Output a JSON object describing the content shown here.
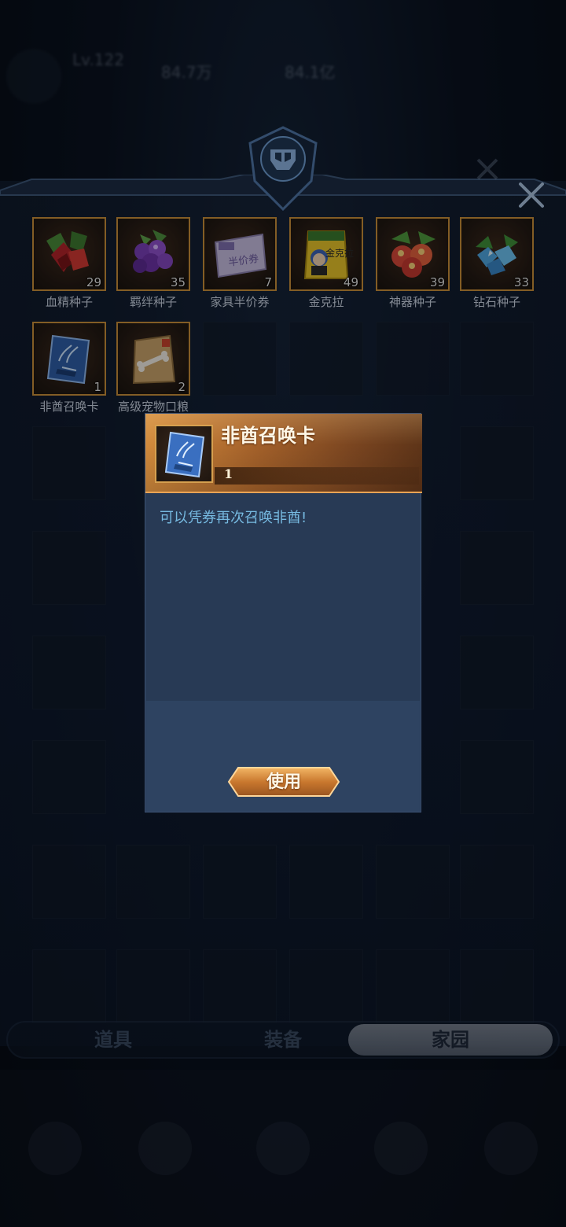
{
  "hud": {
    "level_text": "Lv.122",
    "stat1": "84.7万",
    "stat2": "84.1亿"
  },
  "inventory": {
    "items": [
      {
        "name": "血精种子",
        "count": "29",
        "icon": "blood-seed-icon"
      },
      {
        "name": "羁绊种子",
        "count": "35",
        "icon": "bond-seed-icon"
      },
      {
        "name": "家具半价券",
        "count": "7",
        "icon": "furniture-coupon-icon"
      },
      {
        "name": "金克拉",
        "count": "49",
        "icon": "fertilizer-bag-icon"
      },
      {
        "name": "神器种子",
        "count": "39",
        "icon": "artifact-seed-icon"
      },
      {
        "name": "钻石种子",
        "count": "33",
        "icon": "diamond-seed-icon"
      },
      {
        "name": "非酋召唤卡",
        "count": "1",
        "icon": "summon-card-icon"
      },
      {
        "name": "高级宠物口粮",
        "count": "2",
        "icon": "pet-food-icon"
      }
    ],
    "coupon_text": "半价券",
    "bag_text": "金克拉"
  },
  "tabs": [
    {
      "label": "道具"
    },
    {
      "label": "装备"
    },
    {
      "label": "家园",
      "selected": true
    }
  ],
  "modal": {
    "title": "非酋召唤卡",
    "count": "1",
    "description": "可以凭券再次召唤非酋!",
    "use_label": "使用",
    "icon": "summon-card-icon"
  },
  "colors": {
    "item_border": "#c9903a",
    "modal_header": "#a4612a",
    "desc_text": "#76b9e0",
    "panel_bg": "#17253a"
  }
}
